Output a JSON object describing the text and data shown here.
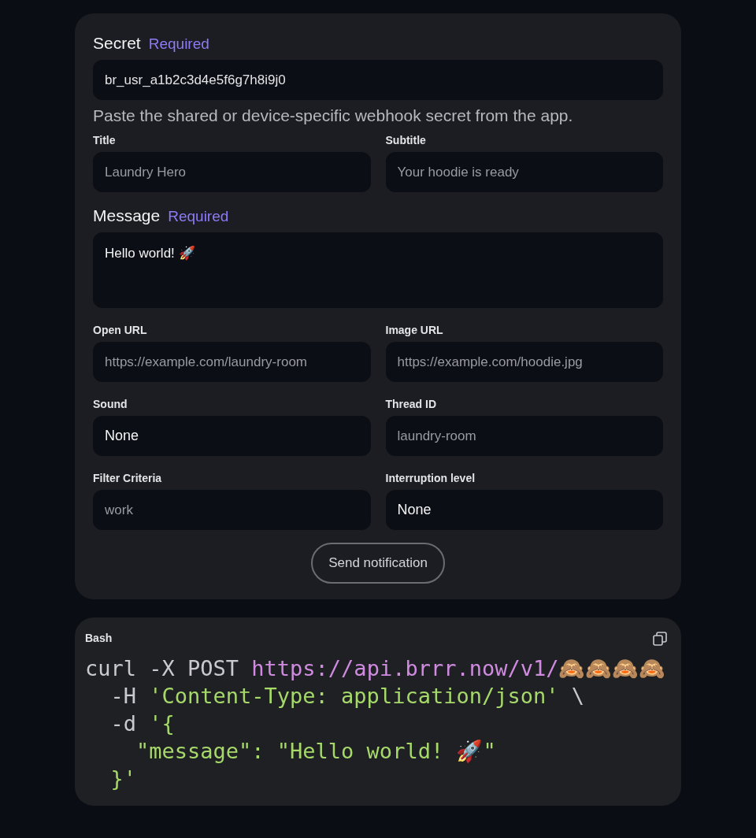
{
  "form": {
    "secret": {
      "label": "Secret",
      "badge": "Required",
      "value": "br_usr_a1b2c3d4e5f6g7h8i9j0",
      "hint": "Paste the shared or device-specific webhook secret from the app."
    },
    "row_1": [
      {
        "kind": "text",
        "label": "Title",
        "placeholder": "Laundry Hero"
      },
      {
        "kind": "text",
        "label": "Subtitle",
        "placeholder": "Your hoodie is ready"
      }
    ],
    "message": {
      "label": "Message",
      "badge": "Required",
      "value": "Hello world! 🚀"
    },
    "rows": [
      [
        {
          "kind": "text",
          "label": "Open URL",
          "placeholder": "https://example.com/laundry-room"
        },
        {
          "kind": "text",
          "label": "Image URL",
          "placeholder": "https://example.com/hoodie.jpg"
        }
      ],
      [
        {
          "kind": "select",
          "label": "Sound",
          "value": "None"
        },
        {
          "kind": "text",
          "label": "Thread ID",
          "placeholder": "laundry-room"
        }
      ],
      [
        {
          "kind": "text",
          "label": "Filter Criteria",
          "placeholder": "work"
        },
        {
          "kind": "select",
          "label": "Interruption level",
          "value": "None"
        }
      ]
    ],
    "submit": "Send notification"
  },
  "code_block": {
    "language": "Bash",
    "lines": [
      [
        {
          "kind": "plain",
          "text": "curl -X POST "
        },
        {
          "kind": "url",
          "text": "https://api.brrr.now/v1/🙈🙈🙈🙈"
        }
      ],
      [
        {
          "kind": "plain",
          "text": "  -H "
        },
        {
          "kind": "string",
          "text": "'Content-Type: application/json'"
        },
        {
          "kind": "plain",
          "text": " \\"
        }
      ],
      [
        {
          "kind": "plain",
          "text": "  -d "
        },
        {
          "kind": "string",
          "text": "'{"
        }
      ],
      [
        {
          "kind": "string",
          "text": "    \"message\": \"Hello world! 🚀\""
        }
      ],
      [
        {
          "kind": "string",
          "text": "  }'"
        }
      ]
    ]
  }
}
